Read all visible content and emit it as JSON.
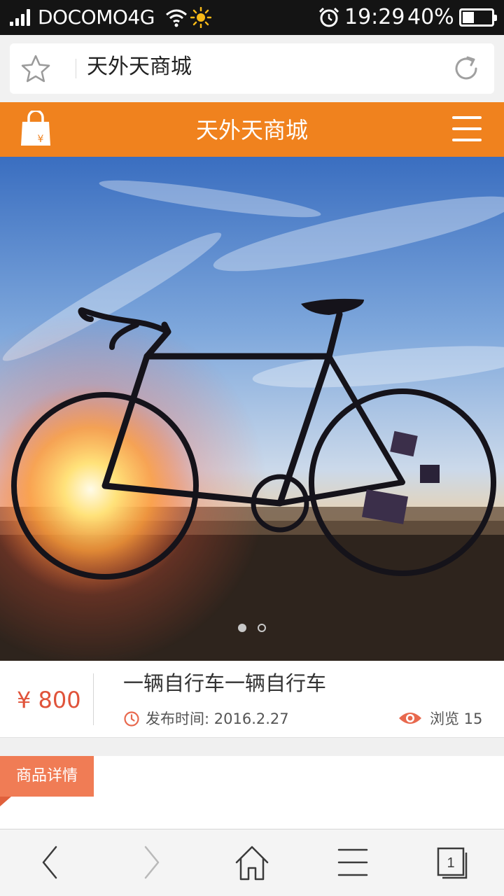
{
  "status_bar": {
    "carrier": "DOCOMO4G",
    "time": "19:29",
    "battery": "40%",
    "battery_level": 0.4
  },
  "browser": {
    "url_text": "天外天商城",
    "icons": [
      "star-icon",
      "reload-icon"
    ]
  },
  "site_header": {
    "title": "天外天商城",
    "logo_glyph": "¥",
    "icons": [
      "shopping-bag-icon",
      "menu-icon"
    ]
  },
  "carousel": {
    "slide_count": 2,
    "active_index": 0
  },
  "product": {
    "price": "¥ 800",
    "title": "一辆自行车一辆自行车",
    "published_label": "发布时间: 2016.2.27",
    "views_label": "浏览 15"
  },
  "details_tab": {
    "label": "商品详情"
  },
  "bottom_nav": {
    "tab_count": "1",
    "icons": [
      "back-icon",
      "forward-icon",
      "home-icon",
      "menu-icon",
      "tabs-icon"
    ]
  },
  "colors": {
    "brand_orange": "#f0821e",
    "price_red": "#e0533a",
    "tag_orange": "#f07c55"
  }
}
